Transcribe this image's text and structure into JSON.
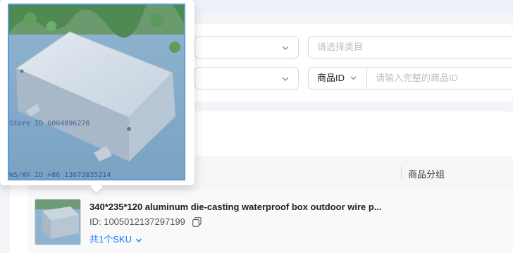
{
  "filters": {
    "category_placeholder": "请选择类目",
    "id_type": "商品ID",
    "id_placeholder": "请输入完整的商品ID"
  },
  "table": {
    "column_group": "商品分组"
  },
  "product": {
    "title": "340*235*120 aluminum die-casting waterproof box outdoor wire p...",
    "id_text": "ID: 1005012137297199",
    "sku_text": "共1个SKU"
  },
  "image_watermarks": {
    "store": "Store ID 6004896270",
    "contact": "WS/WX ID +86 13673835214"
  },
  "colors": {
    "link": "#1677ff",
    "border": "#d9d9d9",
    "popover_border": "#5b9be0"
  }
}
